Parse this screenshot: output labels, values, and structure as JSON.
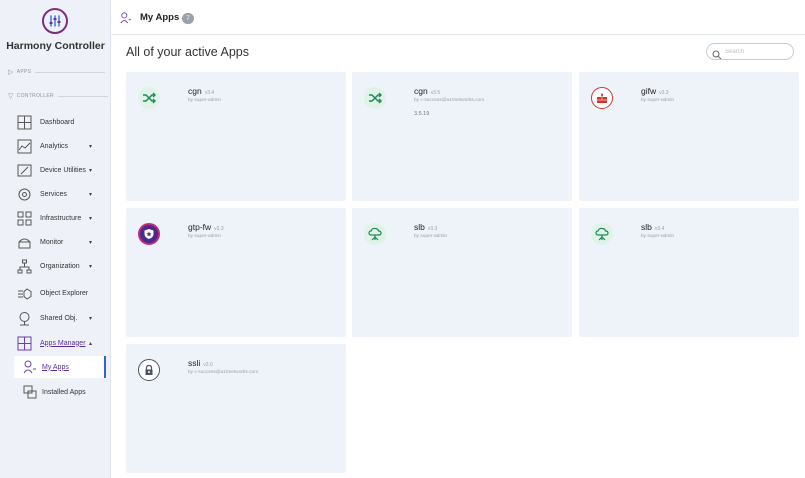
{
  "brand": {
    "name": "Harmony Controller"
  },
  "sidebar": {
    "sections": {
      "apps": "APPS",
      "controller": "CONTROLLER"
    },
    "items": [
      {
        "label": "Dashboard",
        "icon": "dashboard-icon",
        "chevron": ""
      },
      {
        "label": "Analytics",
        "icon": "analytics-icon",
        "chevron": "▾"
      },
      {
        "label": "Device Utilities",
        "icon": "device-utilities-icon",
        "chevron": "▾"
      },
      {
        "label": "Services",
        "icon": "services-icon",
        "chevron": "▾"
      },
      {
        "label": "Infrastructure",
        "icon": "infrastructure-icon",
        "chevron": "▾"
      },
      {
        "label": "Monitor",
        "icon": "monitor-icon",
        "chevron": "▾"
      },
      {
        "label": "Organization",
        "icon": "organization-icon",
        "chevron": "▾"
      },
      {
        "label": "Object Explorer",
        "icon": "object-explorer-icon",
        "chevron": ""
      },
      {
        "label": "Shared Obj.",
        "icon": "shared-obj-icon",
        "chevron": "▾"
      },
      {
        "label": "Apps Manager",
        "icon": "apps-manager-icon",
        "chevron": "▴"
      }
    ],
    "subitems": [
      {
        "label": "My Apps",
        "icon": "my-apps-icon"
      },
      {
        "label": "Installed Apps",
        "icon": "installed-apps-icon"
      }
    ]
  },
  "topbar": {
    "title": "My Apps",
    "count": "7"
  },
  "main": {
    "heading": "All of your active Apps",
    "search": {
      "placeholder": "Search",
      "value": ""
    }
  },
  "apps": [
    {
      "name": "cgn",
      "version": "v3.4",
      "by": "by super-admin",
      "extra": "",
      "icon": "shuffle-icon",
      "color": "#1e8a5a"
    },
    {
      "name": "cgn",
      "version": "v3.5",
      "by": "by c-success@a10networks.com",
      "extra": "3.5.19",
      "icon": "shuffle-icon",
      "color": "#1e8a5a"
    },
    {
      "name": "gifw",
      "version": "v3.3",
      "by": "by super-admin",
      "extra": "",
      "icon": "firewall-icon",
      "color": "#d8332b"
    },
    {
      "name": "gtp-fw",
      "version": "v3.3",
      "by": "by super-admin",
      "extra": "",
      "icon": "shield-star-icon",
      "color": "#4a2a8a"
    },
    {
      "name": "slb",
      "version": "v3.3",
      "by": "by super-admin",
      "extra": "",
      "icon": "cloud-network-icon",
      "color": "#1e8a5a"
    },
    {
      "name": "slb",
      "version": "v3.4",
      "by": "by super-admin",
      "extra": "",
      "icon": "cloud-network-icon",
      "color": "#1e8a5a"
    },
    {
      "name": "ssli",
      "version": "v3.0",
      "by": "by c-success@a10networks.com",
      "extra": "",
      "icon": "lock-icon",
      "color": "#4b5563"
    }
  ],
  "colors": {
    "accent": "#2f65d8",
    "brand": "#7a2f7f",
    "card_bg": "#eef2f9",
    "sidebar_bg": "#eef2f8"
  }
}
